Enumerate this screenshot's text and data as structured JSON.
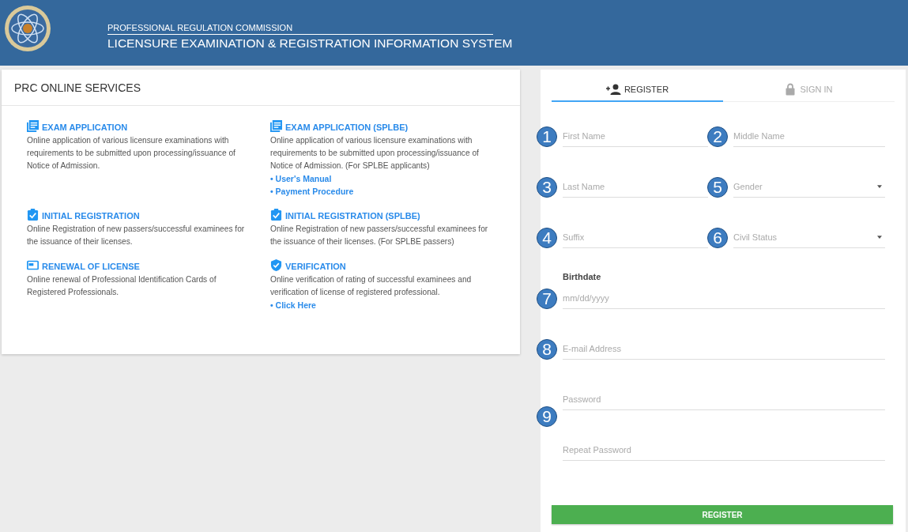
{
  "header": {
    "subtitle": "PROFESSIONAL REGULATION COMMISSION",
    "title": "LICENSURE EXAMINATION & REGISTRATION INFORMATION SYSTEM"
  },
  "services": {
    "title": "PRC ONLINE SERVICES",
    "items": [
      {
        "kind": "document",
        "title": "EXAM APPLICATION",
        "description": "Online application of various licensure examinations with requirements to be submitted upon processing/issuance of Notice of Admission."
      },
      {
        "kind": "document",
        "title": "EXAM APPLICATION (SPLBE)",
        "description": "Online application of various licensure examinations with requirements to be submitted upon processing/issuance of Notice of Admission. (For SPLBE applicants)",
        "links": [
          "• User's Manual",
          "• Payment Procedure"
        ]
      },
      {
        "kind": "clipboard",
        "title": "INITIAL REGISTRATION",
        "description": "Online Registration of new passers/successful examinees for the issuance of their licenses."
      },
      {
        "kind": "clipboard",
        "title": "INITIAL REGISTRATION (SPLBE)",
        "description": "Online Registration of new passers/successful examinees for the issuance of their licenses. (For SPLBE passers)"
      },
      {
        "kind": "card",
        "title": "RENEWAL OF LICENSE",
        "description": "Online renewal of Professional Identification Cards of Registered Professionals."
      },
      {
        "kind": "shield",
        "title": "VERIFICATION",
        "description": "Online verification of rating of successful examinees and verification of license of registered professional.",
        "links": [
          "• Click Here"
        ]
      }
    ]
  },
  "tabs": [
    {
      "label": "REGISTER",
      "kind": "register",
      "selected": true
    },
    {
      "label": "SIGN IN",
      "kind": "signin",
      "selected": false
    }
  ],
  "form": {
    "rows": [
      {
        "kind": "fields",
        "fields": [
          {
            "kind": "input",
            "placeholder": "First Name",
            "marker": "1"
          },
          {
            "kind": "input",
            "placeholder": "Middle Name",
            "marker": "2"
          }
        ]
      },
      {
        "kind": "fields",
        "fields": [
          {
            "kind": "input",
            "placeholder": "Last Name",
            "marker": "3"
          },
          {
            "kind": "select",
            "placeholder": "Gender",
            "marker": "5"
          }
        ]
      },
      {
        "kind": "fields",
        "fields": [
          {
            "kind": "input",
            "placeholder": "Suffix",
            "marker": "4"
          },
          {
            "kind": "select",
            "placeholder": "Civil Status",
            "marker": "6"
          }
        ]
      },
      {
        "kind": "label",
        "text": "Birthdate"
      },
      {
        "kind": "fields",
        "fields": [
          {
            "kind": "input",
            "placeholder": "mm/dd/yyyy",
            "marker": "7"
          }
        ]
      },
      {
        "kind": "fields",
        "fields": [
          {
            "kind": "input",
            "placeholder": "E-mail Address",
            "marker": "8"
          }
        ]
      },
      {
        "kind": "fields",
        "fields": [
          {
            "kind": "input",
            "placeholder": "Password"
          }
        ]
      },
      {
        "kind": "marker",
        "marker": "9"
      },
      {
        "kind": "fields",
        "fields": [
          {
            "kind": "input",
            "placeholder": "Repeat Password"
          }
        ]
      }
    ],
    "submit": "REGISTER"
  }
}
